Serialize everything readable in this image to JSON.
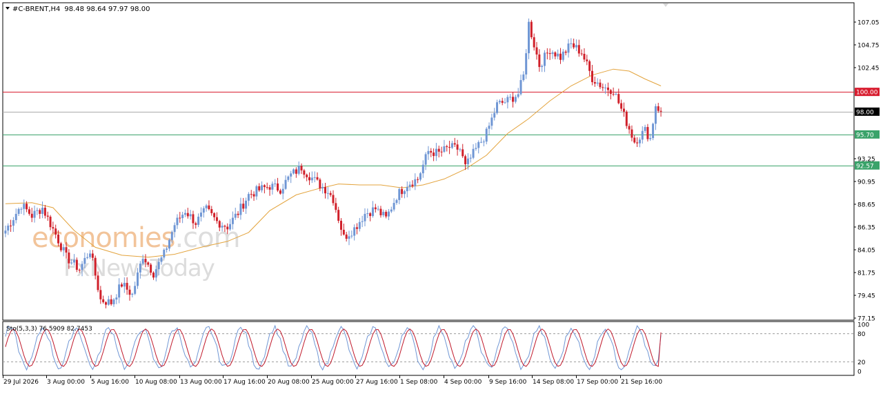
{
  "header": {
    "symbol_text": "#C-BRENT,H4",
    "ohlc_text": "98.48 98.64 97.97 98.00"
  },
  "watermark": {
    "line1_a": "economies",
    "line1_b": ".com",
    "line2": "FxNewsToday"
  },
  "stoch_label": "Sto(5,3,3) 76.5909 82.7453",
  "colors": {
    "bull": "#6f96d4",
    "bear": "#d0202a",
    "ma": "#e3a33c",
    "red_line": "#d81c2e",
    "green_line": "#3aa36a",
    "gray_line": "#aaaaaa",
    "stoch_main": "#6f96d4",
    "stoch_signal": "#c0182a"
  },
  "chart_data": {
    "type": "candlestick",
    "symbol": "#C-BRENT",
    "timeframe": "H4",
    "y_ticks": [
      "107.05",
      "104.75",
      "102.45",
      "100.00",
      "98.00",
      "95.70",
      "93.25",
      "92.57",
      "90.95",
      "88.65",
      "86.35",
      "84.05",
      "81.75",
      "79.45",
      "77.15"
    ],
    "ylim": [
      77.15,
      108.8
    ],
    "x_ticks": [
      "29 Jul 2026",
      "3 Aug 00:00",
      "5 Aug 16:00",
      "10 Aug 08:00",
      "13 Aug 00:00",
      "17 Aug 16:00",
      "20 Aug 08:00",
      "25 Aug 00:00",
      "27 Aug 16:00",
      "1 Sep 08:00",
      "4 Sep 00:00",
      "9 Sep 16:00",
      "14 Sep 08:00",
      "17 Sep 00:00",
      "21 Sep 16:00"
    ],
    "levels": [
      {
        "value": 100.0,
        "label": "100.00",
        "style": "red"
      },
      {
        "value": 98.0,
        "label": "98.00",
        "style": "current"
      },
      {
        "value": 95.7,
        "label": "95.70",
        "style": "green"
      },
      {
        "value": 92.57,
        "label": "92.57",
        "style": "green"
      }
    ],
    "close_path": [
      [
        0,
        86.0
      ],
      [
        6,
        88.6
      ],
      [
        10,
        87.5
      ],
      [
        14,
        88.3
      ],
      [
        19,
        85.6
      ],
      [
        23,
        83.3
      ],
      [
        28,
        82.1
      ],
      [
        32,
        84.0
      ],
      [
        36,
        79.0
      ],
      [
        40,
        78.7
      ],
      [
        44,
        80.6
      ],
      [
        48,
        79.5
      ],
      [
        52,
        83.5
      ],
      [
        56,
        81.7
      ],
      [
        60,
        83.6
      ],
      [
        64,
        86.6
      ],
      [
        68,
        88.0
      ],
      [
        72,
        86.8
      ],
      [
        76,
        88.1
      ],
      [
        80,
        86.9
      ],
      [
        84,
        86.4
      ],
      [
        88,
        87.8
      ],
      [
        92,
        89.6
      ],
      [
        96,
        90.1
      ],
      [
        100,
        90.5
      ],
      [
        104,
        90.2
      ],
      [
        108,
        91.6
      ],
      [
        112,
        92.4
      ],
      [
        114,
        91.8
      ],
      [
        118,
        90.8
      ],
      [
        122,
        90.0
      ],
      [
        124,
        89.2
      ],
      [
        128,
        85.3
      ],
      [
        132,
        86.2
      ],
      [
        136,
        87.7
      ],
      [
        140,
        88.2
      ],
      [
        144,
        87.2
      ],
      [
        148,
        89.5
      ],
      [
        152,
        90.7
      ],
      [
        156,
        91.2
      ],
      [
        160,
        94.0
      ],
      [
        164,
        93.8
      ],
      [
        168,
        94.4
      ],
      [
        172,
        94.2
      ],
      [
        174,
        92.4
      ],
      [
        178,
        94.2
      ],
      [
        182,
        95.8
      ],
      [
        186,
        98.7
      ],
      [
        190,
        99.1
      ],
      [
        194,
        99.8
      ],
      [
        196,
        101.6
      ],
      [
        198,
        106.9
      ],
      [
        202,
        102.7
      ],
      [
        206,
        104.3
      ],
      [
        210,
        103.5
      ],
      [
        214,
        104.8
      ],
      [
        218,
        104.0
      ],
      [
        222,
        101.4
      ],
      [
        226,
        100.5
      ],
      [
        230,
        100.2
      ],
      [
        234,
        97.6
      ],
      [
        238,
        95.0
      ],
      [
        242,
        96.1
      ],
      [
        244,
        95.3
      ],
      [
        246,
        98.7
      ],
      [
        248,
        98.0
      ]
    ],
    "ma_series": [
      [
        0,
        88.7
      ],
      [
        10,
        88.8
      ],
      [
        18,
        88.3
      ],
      [
        26,
        86.0
      ],
      [
        34,
        84.3
      ],
      [
        44,
        83.5
      ],
      [
        54,
        83.3
      ],
      [
        64,
        83.6
      ],
      [
        74,
        84.3
      ],
      [
        84,
        84.9
      ],
      [
        92,
        85.8
      ],
      [
        100,
        88.0
      ],
      [
        110,
        89.6
      ],
      [
        118,
        90.2
      ],
      [
        126,
        90.7
      ],
      [
        134,
        90.6
      ],
      [
        142,
        90.6
      ],
      [
        150,
        90.3
      ],
      [
        158,
        90.6
      ],
      [
        166,
        91.2
      ],
      [
        174,
        92.2
      ],
      [
        182,
        93.6
      ],
      [
        190,
        95.8
      ],
      [
        198,
        97.3
      ],
      [
        206,
        99.1
      ],
      [
        214,
        100.6
      ],
      [
        222,
        101.7
      ],
      [
        230,
        102.3
      ],
      [
        236,
        102.1
      ],
      [
        242,
        101.3
      ],
      [
        248,
        100.6
      ]
    ],
    "stochastic": {
      "params": "5,3,3",
      "main_value": 76.5909,
      "signal_value": 82.7453,
      "ylim": [
        0,
        100
      ],
      "y_ticks": [
        "100",
        "80",
        "20",
        "0"
      ],
      "levels": [
        80,
        20
      ]
    }
  }
}
